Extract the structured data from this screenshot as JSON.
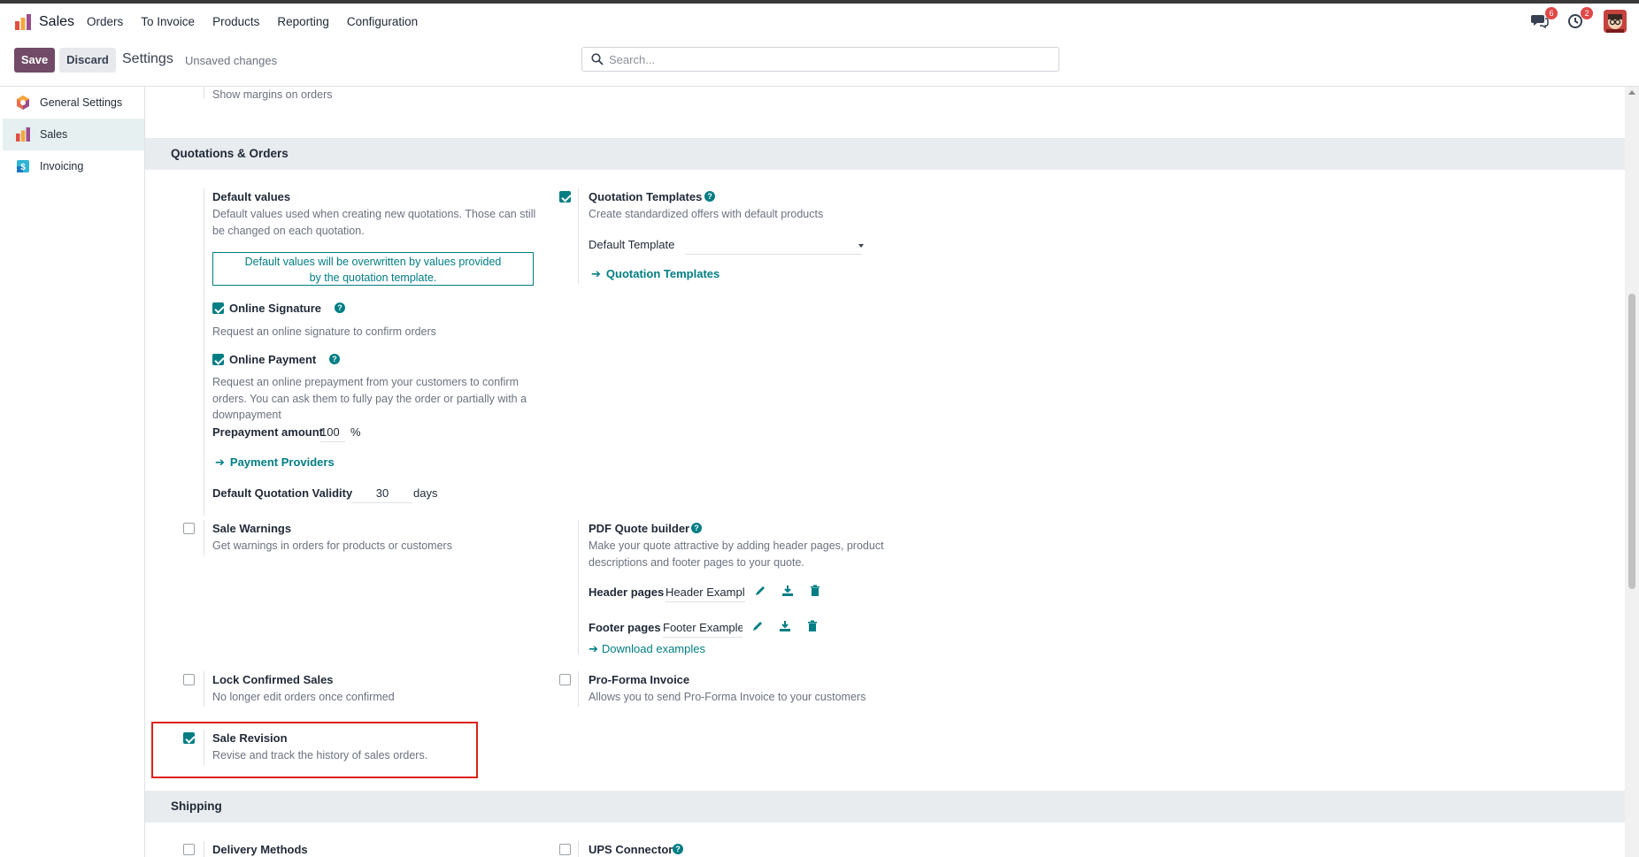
{
  "navbar": {
    "app_name": "Sales",
    "menu": [
      "Orders",
      "To Invoice",
      "Products",
      "Reporting",
      "Configuration"
    ],
    "messages_badge": "6",
    "activities_badge": "2"
  },
  "control_panel": {
    "save_label": "Save",
    "discard_label": "Discard",
    "title": "Settings",
    "unsaved": "Unsaved changes",
    "search_placeholder": "Search..."
  },
  "sidebar": {
    "items": [
      {
        "label": "General Settings",
        "icon": "odoo-settings-icon"
      },
      {
        "label": "Sales",
        "icon": "sales-app-icon",
        "active": true
      },
      {
        "label": "Invoicing",
        "icon": "invoicing-app-icon"
      }
    ]
  },
  "main": {
    "top_desc": "Show margins on orders",
    "quotations_section": "Quotations & Orders",
    "default_values": {
      "title": "Default values",
      "desc": "Default values used when creating new quotations. Those can still be changed on each quotation.",
      "info_line1": "Default values will be overwritten by values provided",
      "info_line2": "by the quotation template."
    },
    "online_signature": {
      "title": "Online Signature",
      "desc": "Request an online signature to confirm orders",
      "checked": true
    },
    "online_payment": {
      "title": "Online Payment",
      "desc": "Request an online prepayment from your customers to confirm orders. You can ask them to fully pay the order or partially with a downpayment",
      "checked": true,
      "prepayment_label": "Prepayment amount",
      "prepayment_value": "100",
      "prepayment_unit": "%",
      "providers_link": "Payment Providers"
    },
    "validity": {
      "label": "Default Quotation Validity",
      "value": "30",
      "unit": "days"
    },
    "quotation_templates": {
      "title": "Quotation Templates",
      "desc": "Create standardized offers with default products",
      "checked": true,
      "default_template_label": "Default Template",
      "default_template_value": "",
      "link": "Quotation Templates"
    },
    "sale_warnings": {
      "title": "Sale Warnings",
      "desc": "Get warnings in orders for products or customers",
      "checked": false
    },
    "pdf_quote_builder": {
      "title": "PDF Quote builder",
      "desc": "Make your quote attractive by adding header pages, product descriptions and footer pages to your quote.",
      "header_label": "Header pages",
      "header_value": "Header Example",
      "footer_label": "Footer pages",
      "footer_value": "Footer Example",
      "download_link": "Download examples"
    },
    "lock_confirmed": {
      "title": "Lock Confirmed Sales",
      "desc": "No longer edit orders once confirmed",
      "checked": false
    },
    "proforma": {
      "title": "Pro-Forma Invoice",
      "desc": "Allows you to send Pro-Forma Invoice to your customers",
      "checked": false
    },
    "sale_revision": {
      "title": "Sale Revision",
      "desc": "Revise and track the history of sales orders.",
      "checked": true
    },
    "shipping_section": "Shipping",
    "delivery_methods": {
      "title": "Delivery Methods",
      "checked": false
    },
    "ups_connector": {
      "title": "UPS Connector",
      "checked": false
    }
  },
  "colors": {
    "brand": "#714b67",
    "accent": "#017e84",
    "highlight": "#e0201a"
  }
}
